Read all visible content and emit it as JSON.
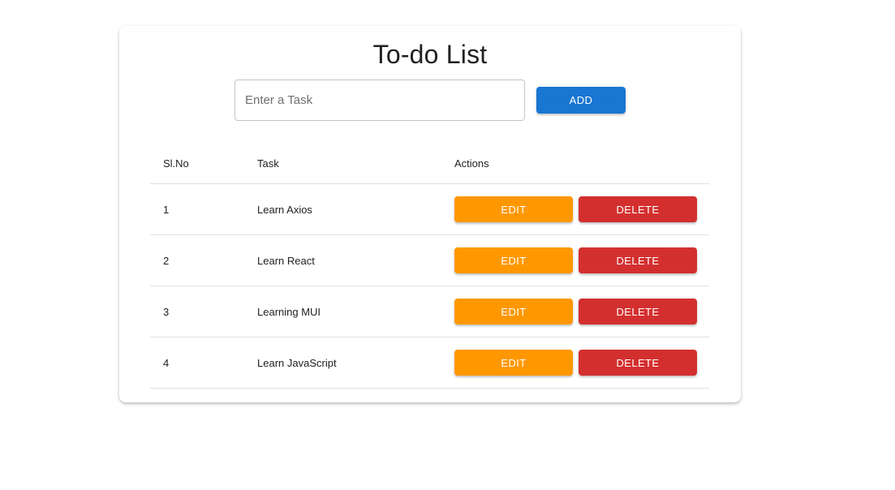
{
  "title": "To-do List",
  "input": {
    "placeholder": "Enter a Task",
    "value": ""
  },
  "add_label": "ADD",
  "table": {
    "headers": [
      "Sl.No",
      "Task",
      "Actions"
    ],
    "rows": [
      {
        "no": "1",
        "task": "Learn Axios",
        "edit": "EDIT",
        "delete": "DELETE"
      },
      {
        "no": "2",
        "task": "Learn React",
        "edit": "EDIT",
        "delete": "DELETE"
      },
      {
        "no": "3",
        "task": "Learning MUI",
        "edit": "EDIT",
        "delete": "DELETE"
      },
      {
        "no": "4",
        "task": "Learn JavaScript",
        "edit": "EDIT",
        "delete": "DELETE"
      }
    ]
  },
  "colors": {
    "add": "#1976d2",
    "edit": "#ff9800",
    "delete": "#d32f2f"
  }
}
